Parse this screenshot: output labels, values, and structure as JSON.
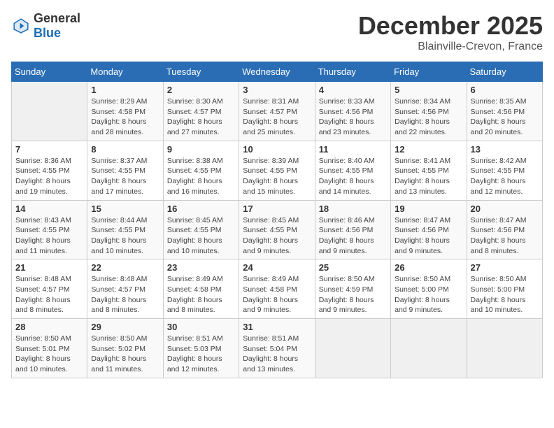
{
  "header": {
    "logo_general": "General",
    "logo_blue": "Blue",
    "month_title": "December 2025",
    "location": "Blainville-Crevon, France"
  },
  "days_of_week": [
    "Sunday",
    "Monday",
    "Tuesday",
    "Wednesday",
    "Thursday",
    "Friday",
    "Saturday"
  ],
  "weeks": [
    [
      {
        "day": "",
        "sunrise": "",
        "sunset": "",
        "daylight": ""
      },
      {
        "day": "1",
        "sunrise": "Sunrise: 8:29 AM",
        "sunset": "Sunset: 4:58 PM",
        "daylight": "Daylight: 8 hours and 28 minutes."
      },
      {
        "day": "2",
        "sunrise": "Sunrise: 8:30 AM",
        "sunset": "Sunset: 4:57 PM",
        "daylight": "Daylight: 8 hours and 27 minutes."
      },
      {
        "day": "3",
        "sunrise": "Sunrise: 8:31 AM",
        "sunset": "Sunset: 4:57 PM",
        "daylight": "Daylight: 8 hours and 25 minutes."
      },
      {
        "day": "4",
        "sunrise": "Sunrise: 8:33 AM",
        "sunset": "Sunset: 4:56 PM",
        "daylight": "Daylight: 8 hours and 23 minutes."
      },
      {
        "day": "5",
        "sunrise": "Sunrise: 8:34 AM",
        "sunset": "Sunset: 4:56 PM",
        "daylight": "Daylight: 8 hours and 22 minutes."
      },
      {
        "day": "6",
        "sunrise": "Sunrise: 8:35 AM",
        "sunset": "Sunset: 4:56 PM",
        "daylight": "Daylight: 8 hours and 20 minutes."
      }
    ],
    [
      {
        "day": "7",
        "sunrise": "Sunrise: 8:36 AM",
        "sunset": "Sunset: 4:55 PM",
        "daylight": "Daylight: 8 hours and 19 minutes."
      },
      {
        "day": "8",
        "sunrise": "Sunrise: 8:37 AM",
        "sunset": "Sunset: 4:55 PM",
        "daylight": "Daylight: 8 hours and 17 minutes."
      },
      {
        "day": "9",
        "sunrise": "Sunrise: 8:38 AM",
        "sunset": "Sunset: 4:55 PM",
        "daylight": "Daylight: 8 hours and 16 minutes."
      },
      {
        "day": "10",
        "sunrise": "Sunrise: 8:39 AM",
        "sunset": "Sunset: 4:55 PM",
        "daylight": "Daylight: 8 hours and 15 minutes."
      },
      {
        "day": "11",
        "sunrise": "Sunrise: 8:40 AM",
        "sunset": "Sunset: 4:55 PM",
        "daylight": "Daylight: 8 hours and 14 minutes."
      },
      {
        "day": "12",
        "sunrise": "Sunrise: 8:41 AM",
        "sunset": "Sunset: 4:55 PM",
        "daylight": "Daylight: 8 hours and 13 minutes."
      },
      {
        "day": "13",
        "sunrise": "Sunrise: 8:42 AM",
        "sunset": "Sunset: 4:55 PM",
        "daylight": "Daylight: 8 hours and 12 minutes."
      }
    ],
    [
      {
        "day": "14",
        "sunrise": "Sunrise: 8:43 AM",
        "sunset": "Sunset: 4:55 PM",
        "daylight": "Daylight: 8 hours and 11 minutes."
      },
      {
        "day": "15",
        "sunrise": "Sunrise: 8:44 AM",
        "sunset": "Sunset: 4:55 PM",
        "daylight": "Daylight: 8 hours and 10 minutes."
      },
      {
        "day": "16",
        "sunrise": "Sunrise: 8:45 AM",
        "sunset": "Sunset: 4:55 PM",
        "daylight": "Daylight: 8 hours and 10 minutes."
      },
      {
        "day": "17",
        "sunrise": "Sunrise: 8:45 AM",
        "sunset": "Sunset: 4:55 PM",
        "daylight": "Daylight: 8 hours and 9 minutes."
      },
      {
        "day": "18",
        "sunrise": "Sunrise: 8:46 AM",
        "sunset": "Sunset: 4:56 PM",
        "daylight": "Daylight: 8 hours and 9 minutes."
      },
      {
        "day": "19",
        "sunrise": "Sunrise: 8:47 AM",
        "sunset": "Sunset: 4:56 PM",
        "daylight": "Daylight: 8 hours and 9 minutes."
      },
      {
        "day": "20",
        "sunrise": "Sunrise: 8:47 AM",
        "sunset": "Sunset: 4:56 PM",
        "daylight": "Daylight: 8 hours and 8 minutes."
      }
    ],
    [
      {
        "day": "21",
        "sunrise": "Sunrise: 8:48 AM",
        "sunset": "Sunset: 4:57 PM",
        "daylight": "Daylight: 8 hours and 8 minutes."
      },
      {
        "day": "22",
        "sunrise": "Sunrise: 8:48 AM",
        "sunset": "Sunset: 4:57 PM",
        "daylight": "Daylight: 8 hours and 8 minutes."
      },
      {
        "day": "23",
        "sunrise": "Sunrise: 8:49 AM",
        "sunset": "Sunset: 4:58 PM",
        "daylight": "Daylight: 8 hours and 8 minutes."
      },
      {
        "day": "24",
        "sunrise": "Sunrise: 8:49 AM",
        "sunset": "Sunset: 4:58 PM",
        "daylight": "Daylight: 8 hours and 9 minutes."
      },
      {
        "day": "25",
        "sunrise": "Sunrise: 8:50 AM",
        "sunset": "Sunset: 4:59 PM",
        "daylight": "Daylight: 8 hours and 9 minutes."
      },
      {
        "day": "26",
        "sunrise": "Sunrise: 8:50 AM",
        "sunset": "Sunset: 5:00 PM",
        "daylight": "Daylight: 8 hours and 9 minutes."
      },
      {
        "day": "27",
        "sunrise": "Sunrise: 8:50 AM",
        "sunset": "Sunset: 5:00 PM",
        "daylight": "Daylight: 8 hours and 10 minutes."
      }
    ],
    [
      {
        "day": "28",
        "sunrise": "Sunrise: 8:50 AM",
        "sunset": "Sunset: 5:01 PM",
        "daylight": "Daylight: 8 hours and 10 minutes."
      },
      {
        "day": "29",
        "sunrise": "Sunrise: 8:50 AM",
        "sunset": "Sunset: 5:02 PM",
        "daylight": "Daylight: 8 hours and 11 minutes."
      },
      {
        "day": "30",
        "sunrise": "Sunrise: 8:51 AM",
        "sunset": "Sunset: 5:03 PM",
        "daylight": "Daylight: 8 hours and 12 minutes."
      },
      {
        "day": "31",
        "sunrise": "Sunrise: 8:51 AM",
        "sunset": "Sunset: 5:04 PM",
        "daylight": "Daylight: 8 hours and 13 minutes."
      },
      {
        "day": "",
        "sunrise": "",
        "sunset": "",
        "daylight": ""
      },
      {
        "day": "",
        "sunrise": "",
        "sunset": "",
        "daylight": ""
      },
      {
        "day": "",
        "sunrise": "",
        "sunset": "",
        "daylight": ""
      }
    ]
  ]
}
